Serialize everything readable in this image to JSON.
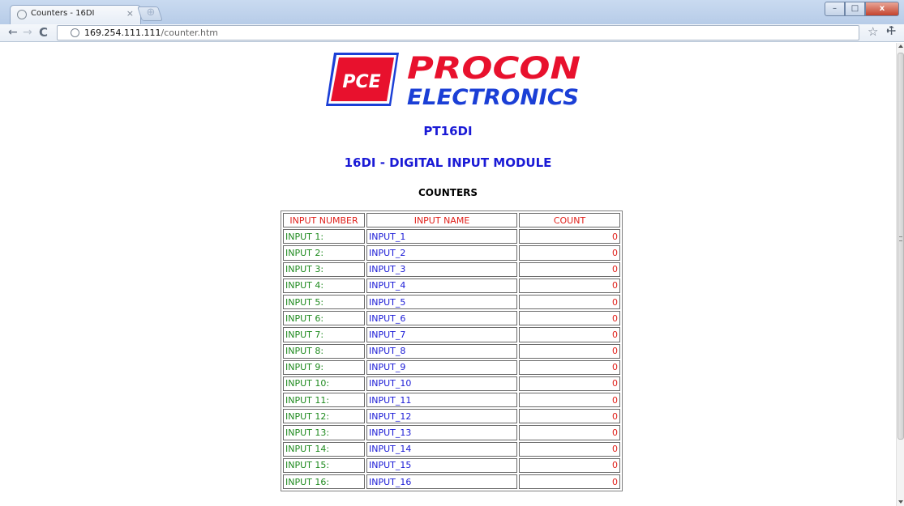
{
  "browser": {
    "tab_title": "Counters - 16DI",
    "tab_close": "×",
    "new_tab": "⊕",
    "window_buttons": {
      "minimize": "–",
      "maximize": "□",
      "close": "x"
    },
    "url_host": "169.254.111.111",
    "url_path": "/counter.htm",
    "icons": [
      "back-arrow-icon",
      "forward-arrow-icon",
      "reload-icon",
      "globe-icon",
      "star-icon",
      "wrench-icon"
    ]
  },
  "logo": {
    "badge": "PCE",
    "line1": "PROCON",
    "line2": "ELECTRONICS",
    "color_red": "#e8112d",
    "color_blue": "#1b3fd6"
  },
  "page": {
    "model": "PT16DI",
    "module_title": "16DI - DIGITAL INPUT MODULE",
    "section_title": "COUNTERS"
  },
  "table": {
    "headers": [
      "INPUT NUMBER",
      "INPUT NAME",
      "COUNT"
    ],
    "rows": [
      {
        "number": "INPUT 1:",
        "name": "INPUT_1",
        "count": "0"
      },
      {
        "number": "INPUT 2:",
        "name": "INPUT_2",
        "count": "0"
      },
      {
        "number": "INPUT 3:",
        "name": "INPUT_3",
        "count": "0"
      },
      {
        "number": "INPUT 4:",
        "name": "INPUT_4",
        "count": "0"
      },
      {
        "number": "INPUT 5:",
        "name": "INPUT_5",
        "count": "0"
      },
      {
        "number": "INPUT 6:",
        "name": "INPUT_6",
        "count": "0"
      },
      {
        "number": "INPUT 7:",
        "name": "INPUT_7",
        "count": "0"
      },
      {
        "number": "INPUT 8:",
        "name": "INPUT_8",
        "count": "0"
      },
      {
        "number": "INPUT 9:",
        "name": "INPUT_9",
        "count": "0"
      },
      {
        "number": "INPUT 10:",
        "name": "INPUT_10",
        "count": "0"
      },
      {
        "number": "INPUT 11:",
        "name": "INPUT_11",
        "count": "0"
      },
      {
        "number": "INPUT 12:",
        "name": "INPUT_12",
        "count": "0"
      },
      {
        "number": "INPUT 13:",
        "name": "INPUT_13",
        "count": "0"
      },
      {
        "number": "INPUT 14:",
        "name": "INPUT_14",
        "count": "0"
      },
      {
        "number": "INPUT 15:",
        "name": "INPUT_15",
        "count": "0"
      },
      {
        "number": "INPUT 16:",
        "name": "INPUT_16",
        "count": "0"
      }
    ],
    "colors": {
      "header": "#e0201a",
      "number": "#1e8a1e",
      "name": "#1a1ad6",
      "count": "#e0201a"
    }
  }
}
